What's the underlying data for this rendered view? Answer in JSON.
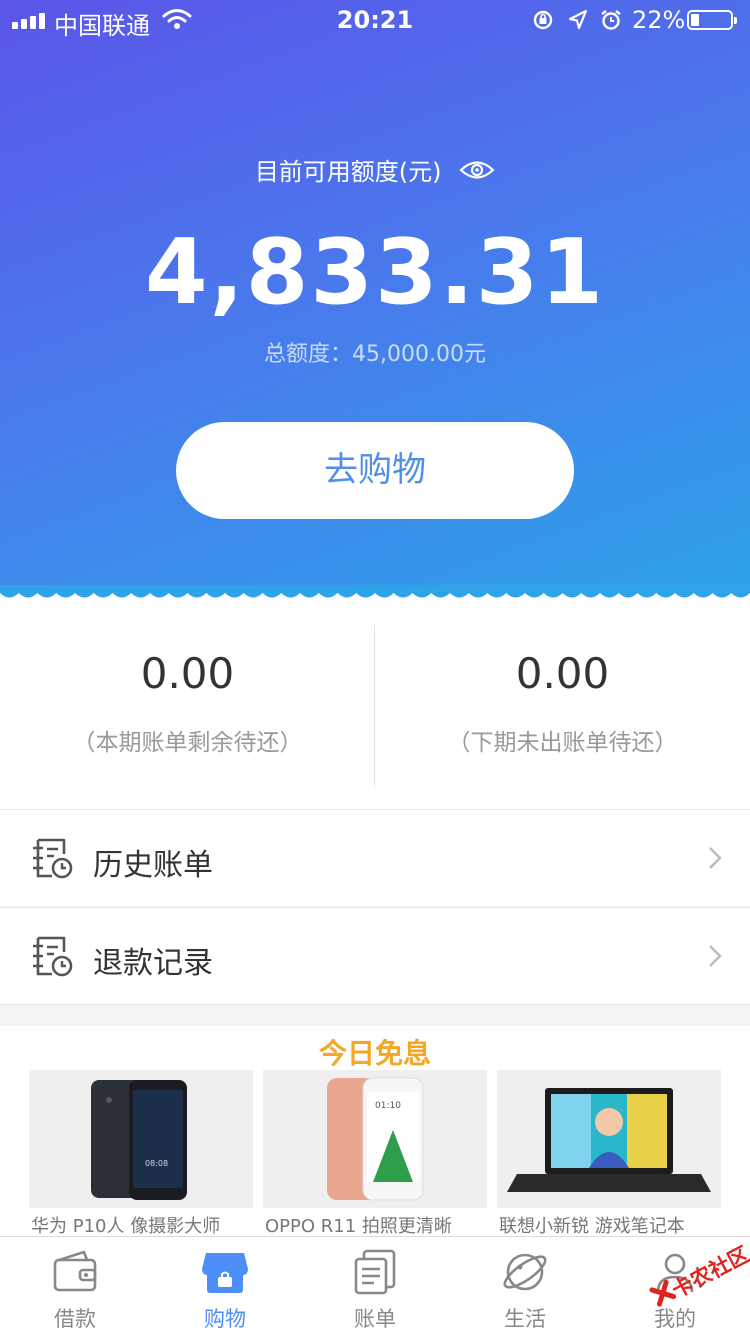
{
  "status_bar": {
    "carrier": "中国联通",
    "time": "20:21",
    "battery": "22%",
    "battery_level": 0.22
  },
  "credit": {
    "label": "目前可用额度(元)",
    "available": "4,833.31",
    "total": "总额度：45,000.00元"
  },
  "shop_button": {
    "label": "去购物"
  },
  "summary": [
    {
      "amount": "0.00",
      "label": "（本期账单剩余待还）"
    },
    {
      "amount": "0.00",
      "label": "（下期未出账单待还）"
    }
  ],
  "menu": [
    {
      "label": "历史账单",
      "icon": "bill-history-icon"
    },
    {
      "label": "退款记录",
      "icon": "refund-record-icon"
    }
  ],
  "promo": {
    "title": "今日免息",
    "products": [
      {
        "caption": "华为 P10人 像摄影大师",
        "image": "phone-black"
      },
      {
        "caption": "OPPO R11 拍照更清晰",
        "image": "phone-rose-gold"
      },
      {
        "caption": "联想小新锐 游戏笔记本",
        "image": "laptop"
      }
    ]
  },
  "tabs": [
    {
      "label": "借款",
      "icon": "wallet-icon",
      "active": false
    },
    {
      "label": "购物",
      "icon": "store-icon",
      "active": true
    },
    {
      "label": "账单",
      "icon": "bill-icon",
      "active": false
    },
    {
      "label": "生活",
      "icon": "planet-icon",
      "active": false
    },
    {
      "label": "我的",
      "icon": "user-icon",
      "active": false
    }
  ],
  "watermark": {
    "text": "卡农社区"
  },
  "colors": {
    "gradient_start": "#5a55e8",
    "gradient_end": "#2ea3ea",
    "accent": "#4d8ef7",
    "promo_title": "#f5a623"
  }
}
